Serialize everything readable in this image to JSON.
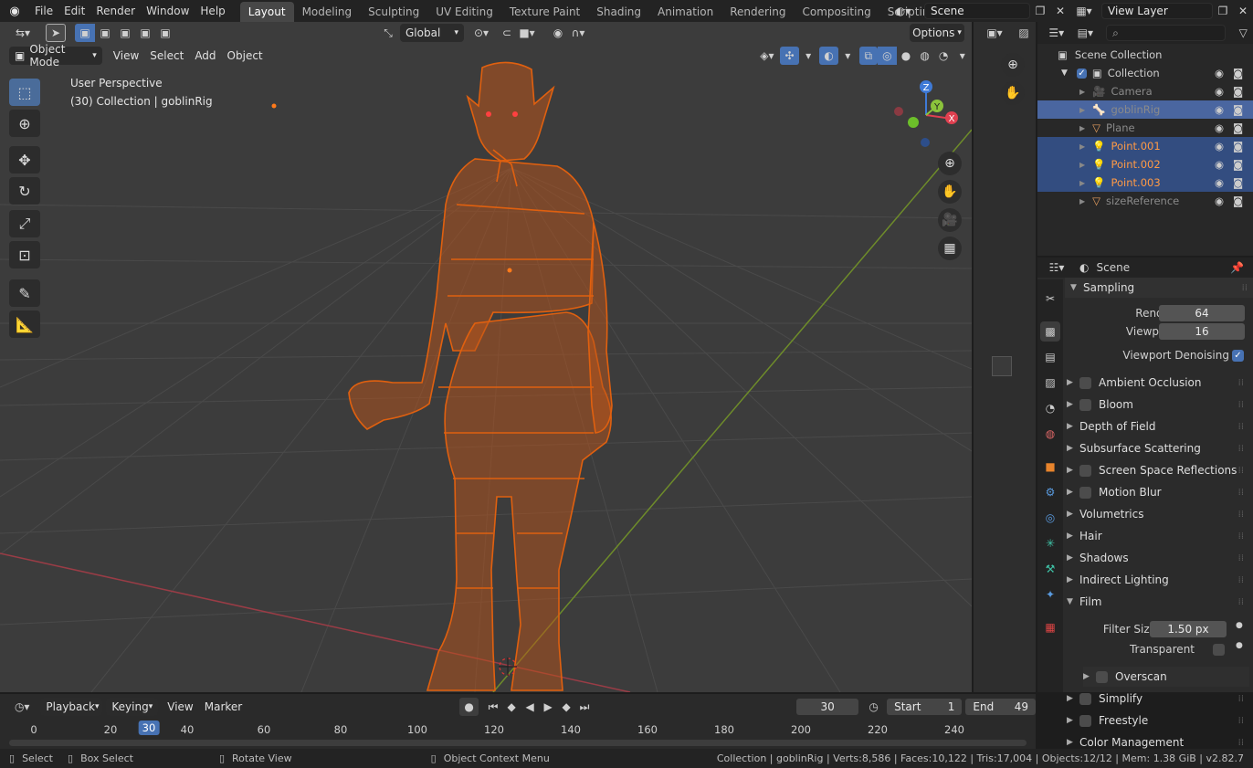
{
  "topbar": {
    "menus": [
      "File",
      "Edit",
      "Render",
      "Window",
      "Help"
    ],
    "workspaces": [
      "Layout",
      "Modeling",
      "Sculpting",
      "UV Editing",
      "Texture Paint",
      "Shading",
      "Animation",
      "Rendering",
      "Compositing",
      "Scripting"
    ],
    "active_workspace": "Layout",
    "add_tab": "+",
    "scene": "Scene",
    "view_layer": "View Layer"
  },
  "viewport": {
    "transform_orientation": "Global",
    "options": "Options",
    "mode": "Object Mode",
    "menus": [
      "View",
      "Select",
      "Add",
      "Object"
    ],
    "overlay_line1": "User Perspective",
    "overlay_line2": "(30) Collection | goblinRig",
    "gizmo": {
      "x": "X",
      "y": "Y",
      "z": "Z"
    }
  },
  "outliner": {
    "search_placeholder": "",
    "root": "Scene Collection",
    "collection": "Collection",
    "items": [
      {
        "name": "Camera",
        "selected": false,
        "active": false,
        "dim": true
      },
      {
        "name": "goblinRig",
        "selected": true,
        "active": true,
        "dim": true
      },
      {
        "name": "Plane",
        "selected": false,
        "active": false,
        "dim": true
      },
      {
        "name": "Point.001",
        "selected": true,
        "active": false,
        "dim": false
      },
      {
        "name": "Point.002",
        "selected": true,
        "active": false,
        "dim": false
      },
      {
        "name": "Point.003",
        "selected": true,
        "active": false,
        "dim": false
      },
      {
        "name": "sizeReference",
        "selected": false,
        "active": false,
        "dim": true
      }
    ]
  },
  "properties": {
    "context": "Scene",
    "sampling": {
      "title": "Sampling",
      "render_label": "Render",
      "render_value": "64",
      "viewport_label": "Viewport",
      "viewport_value": "16",
      "denoise_label": "Viewport Denoising"
    },
    "panels": [
      {
        "label": "Ambient Occlusion",
        "checkbox": true
      },
      {
        "label": "Bloom",
        "checkbox": true
      },
      {
        "label": "Depth of Field",
        "checkbox": false
      },
      {
        "label": "Subsurface Scattering",
        "checkbox": false
      },
      {
        "label": "Screen Space Reflections",
        "checkbox": true
      },
      {
        "label": "Motion Blur",
        "checkbox": true
      },
      {
        "label": "Volumetrics",
        "checkbox": false
      },
      {
        "label": "Hair",
        "checkbox": false
      },
      {
        "label": "Shadows",
        "checkbox": false
      },
      {
        "label": "Indirect Lighting",
        "checkbox": false
      }
    ],
    "film": {
      "title": "Film",
      "filter_label": "Filter Size",
      "filter_value": "1.50 px",
      "transparent_label": "Transparent",
      "overscan_label": "Overscan"
    },
    "more_panels": [
      {
        "label": "Simplify",
        "checkbox": true
      },
      {
        "label": "Freestyle",
        "checkbox": true
      },
      {
        "label": "Color Management",
        "checkbox": false
      }
    ]
  },
  "timeline": {
    "menus": [
      "Playback",
      "Keying",
      "View",
      "Marker"
    ],
    "current_frame": "30",
    "start_label": "Start",
    "start_value": "1",
    "end_label": "End",
    "end_value": "49",
    "ticks": [
      "0",
      "20",
      "30",
      "40",
      "60",
      "80",
      "100",
      "120",
      "140",
      "160",
      "180",
      "200",
      "220",
      "240"
    ]
  },
  "status": {
    "select": "Select",
    "box_select": "Box Select",
    "rotate_view": "Rotate View",
    "context_menu": "Object Context Menu",
    "stats": "Collection | goblinRig | Verts:8,586 | Faces:10,122 | Tris:17,004 | Objects:12/12 | Mem: 1.38 GiB | v2.82.7"
  },
  "colors": {
    "accent": "#4772b3",
    "selection": "#ff7a1a",
    "wire": "#e06010",
    "header": "#232323",
    "viewport": "#3c3c3c"
  }
}
